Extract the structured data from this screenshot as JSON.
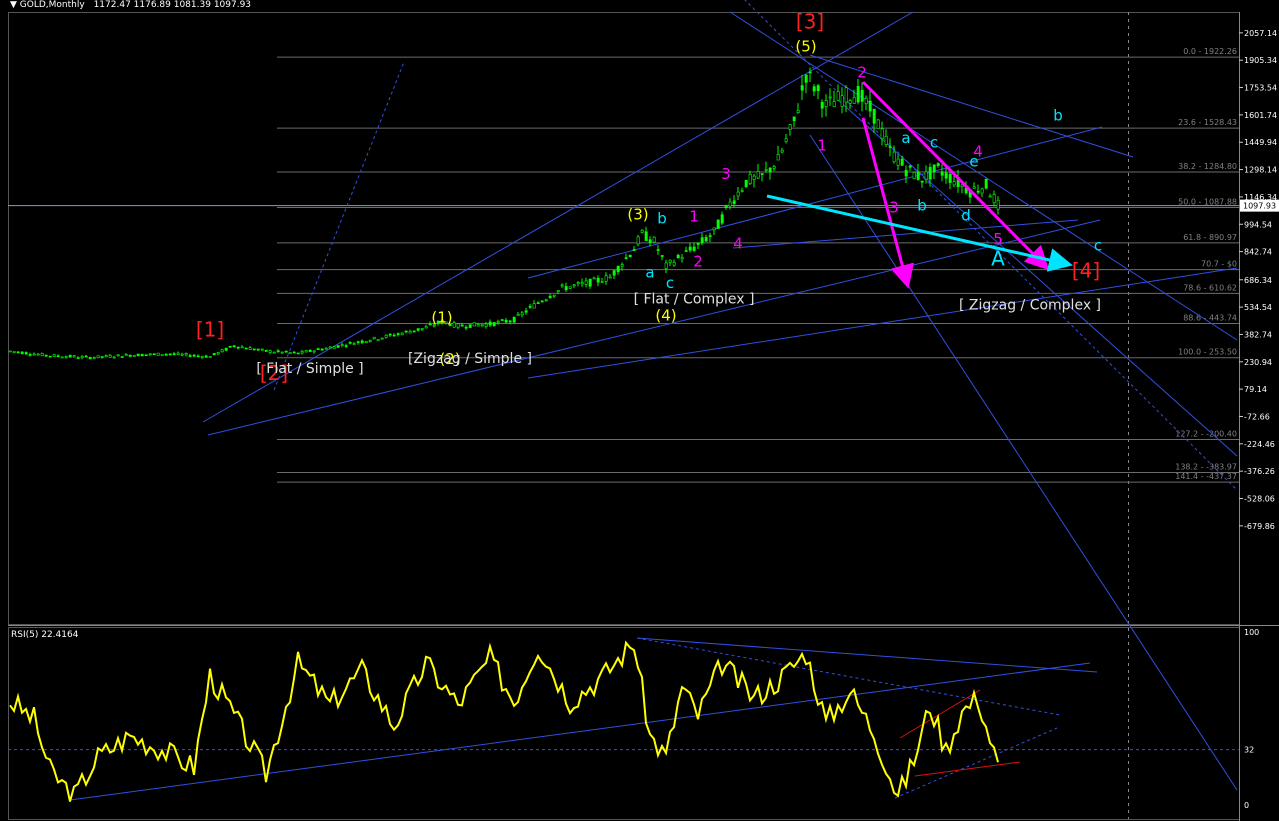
{
  "window": {
    "symbol": "GOLD,Monthly",
    "ohlc": "1172.47 1176.89 1081.39 1097.93"
  },
  "colors": {
    "background": "#000000",
    "grid": "#2a2a2a",
    "axis_text": "#ffffff",
    "candle": "#00ff00",
    "trendline": "#3050e0",
    "fib_line": "#6b6b6b",
    "fib_text": "#808080",
    "rsi_line": "#ffff00",
    "label_red": "#ff2020",
    "label_yellow": "#ffff00",
    "label_magenta": "#ff00ff",
    "label_cyan": "#00e5ff",
    "label_white": "#e0e0e0",
    "price_box_bg": "#ffffff",
    "price_box_text": "#000000"
  },
  "price_panel": {
    "current_price": "1097.93",
    "axis_ticks": [
      {
        "label": "2057.14",
        "value": 2057.14
      },
      {
        "label": "1905.34",
        "value": 1905.34
      },
      {
        "label": "1753.54",
        "value": 1753.54
      },
      {
        "label": "1601.74",
        "value": 1601.74
      },
      {
        "label": "1449.94",
        "value": 1449.94
      },
      {
        "label": "1298.14",
        "value": 1298.14
      },
      {
        "label": "1146.34",
        "value": 1146.34
      },
      {
        "label": "994.54",
        "value": 994.54
      },
      {
        "label": "842.74",
        "value": 842.74
      },
      {
        "label": "686.34",
        "value": 686.34
      },
      {
        "label": "534.54",
        "value": 534.54
      },
      {
        "label": "382.74",
        "value": 382.74
      },
      {
        "label": "230.94",
        "value": 230.94
      },
      {
        "label": "79.14",
        "value": 79.14
      },
      {
        "label": "-72.66",
        "value": -72.66
      },
      {
        "label": "-224.46",
        "value": -224.46
      },
      {
        "label": "-376.26",
        "value": -376.26
      },
      {
        "label": "-528.06",
        "value": -528.06
      },
      {
        "label": "-679.86",
        "value": -679.86
      }
    ],
    "fib_levels": [
      {
        "label": "0.0 - 1922.26",
        "value": 1922.26
      },
      {
        "label": "23.6 - 1528.43",
        "value": 1528.43
      },
      {
        "label": "38.2 - 1284.80",
        "value": 1284.8
      },
      {
        "label": "50.0 - 1087.88",
        "value": 1087.88
      },
      {
        "label": "61.8 - 890.97",
        "value": 890.97
      },
      {
        "label": "70.7 - $0",
        "value": 742.5
      },
      {
        "label": "78.6 - 610.62",
        "value": 610.62
      },
      {
        "label": "88.6 - 443.74",
        "value": 443.74
      },
      {
        "label": "100.0 - 253.50",
        "value": 253.5
      },
      {
        "label": "127.2 - -200.40",
        "value": -200.4
      },
      {
        "label": "138.2 - -383.97",
        "value": -383.97
      },
      {
        "label": "141.4 - -437.37",
        "value": -437.37
      }
    ],
    "wave_labels": [
      {
        "text": "[1]",
        "color": "red",
        "price": 370,
        "bar": 50
      },
      {
        "text": "[2]",
        "color": "red",
        "price": 130,
        "bar": 66
      },
      {
        "text": "[3]",
        "color": "red",
        "price": 2080,
        "bar": 200
      },
      {
        "text": "[4]",
        "color": "red",
        "price": 700,
        "bar": 269
      },
      {
        "text": "(1)",
        "color": "yellow",
        "price": 450,
        "bar": 108
      },
      {
        "text": "(2)",
        "color": "yellow",
        "price": 220,
        "bar": 110
      },
      {
        "text": "(3)",
        "color": "yellow",
        "price": 1020,
        "bar": 157
      },
      {
        "text": "(4)",
        "color": "yellow",
        "price": 460,
        "bar": 164
      },
      {
        "text": "(5)",
        "color": "yellow",
        "price": 1955,
        "bar": 199
      },
      {
        "text": "[Zigzag / Simple ]",
        "color": "white",
        "price": 225,
        "bar": 115
      },
      {
        "text": "[ Flat / Simple ]",
        "color": "white",
        "price": 170,
        "bar": 75
      },
      {
        "text": "[ Flat / Complex ]",
        "color": "white",
        "price": 555,
        "bar": 171
      },
      {
        "text": "[ Zigzag / Complex ]",
        "color": "white",
        "price": 520,
        "bar": 255
      },
      {
        "text": "a",
        "color": "cyan",
        "price": 700,
        "bar": 160
      },
      {
        "text": "b",
        "color": "cyan",
        "price": 1000,
        "bar": 163
      },
      {
        "text": "c",
        "color": "cyan",
        "price": 640,
        "bar": 165
      },
      {
        "text": "1",
        "color": "magenta",
        "price": 1010,
        "bar": 171
      },
      {
        "text": "2",
        "color": "magenta",
        "price": 760,
        "bar": 172
      },
      {
        "text": "3",
        "color": "magenta",
        "price": 1245,
        "bar": 179
      },
      {
        "text": "4",
        "color": "magenta",
        "price": 860,
        "bar": 182
      },
      {
        "text": "1",
        "color": "magenta",
        "price": 1405,
        "bar": 203
      },
      {
        "text": "2",
        "color": "magenta",
        "price": 1810,
        "bar": 213
      },
      {
        "text": "3",
        "color": "magenta",
        "price": 1060,
        "bar": 221
      },
      {
        "text": "4",
        "color": "magenta",
        "price": 1370,
        "bar": 242
      },
      {
        "text": "5",
        "color": "magenta",
        "price": 885,
        "bar": 247
      },
      {
        "text": "a",
        "color": "cyan",
        "price": 1445,
        "bar": 224
      },
      {
        "text": "b",
        "color": "cyan",
        "price": 1070,
        "bar": 228
      },
      {
        "text": "c",
        "color": "cyan",
        "price": 1420,
        "bar": 231
      },
      {
        "text": "d",
        "color": "cyan",
        "price": 1015,
        "bar": 239
      },
      {
        "text": "e",
        "color": "cyan",
        "price": 1315,
        "bar": 241
      },
      {
        "text": "A",
        "color": "cyan",
        "price": 765,
        "bar": 247
      },
      {
        "text": "b",
        "color": "cyan",
        "price": 1570,
        "bar": 262
      },
      {
        "text": "c",
        "color": "cyan",
        "price": 850,
        "bar": 272
      }
    ]
  },
  "rsi_panel": {
    "title": "RSI(5) 22.4164",
    "axis_ticks": [
      {
        "label": "100",
        "value": 100
      },
      {
        "label": "32",
        "value": 32
      },
      {
        "label": "0",
        "value": 0
      }
    ],
    "level": 32
  },
  "chart_data": {
    "type": "line",
    "title": "GOLD,Monthly",
    "series": [
      {
        "name": "GOLD,Monthly",
        "description_points": [
          {
            "bar": 0,
            "close": 290
          },
          {
            "bar": 10,
            "close": 265
          },
          {
            "bar": 20,
            "close": 255
          },
          {
            "bar": 30,
            "close": 268
          },
          {
            "bar": 40,
            "close": 275
          },
          {
            "bar": 48,
            "close": 262
          },
          {
            "bar": 50,
            "close": 260
          },
          {
            "bar": 56,
            "close": 320
          },
          {
            "bar": 64,
            "close": 290
          },
          {
            "bar": 72,
            "close": 278
          },
          {
            "bar": 80,
            "close": 310
          },
          {
            "bar": 88,
            "close": 345
          },
          {
            "bar": 96,
            "close": 380
          },
          {
            "bar": 104,
            "close": 420
          },
          {
            "bar": 108,
            "close": 455
          },
          {
            "bar": 112,
            "close": 430
          },
          {
            "bar": 120,
            "close": 440
          },
          {
            "bar": 126,
            "close": 465
          },
          {
            "bar": 132,
            "close": 560
          },
          {
            "bar": 138,
            "close": 640
          },
          {
            "bar": 144,
            "close": 665
          },
          {
            "bar": 150,
            "close": 700
          },
          {
            "bar": 156,
            "close": 860
          },
          {
            "bar": 158,
            "close": 940
          },
          {
            "bar": 161,
            "close": 900
          },
          {
            "bar": 164,
            "close": 760
          },
          {
            "bar": 168,
            "close": 820
          },
          {
            "bar": 172,
            "close": 880
          },
          {
            "bar": 176,
            "close": 950
          },
          {
            "bar": 180,
            "close": 1110
          },
          {
            "bar": 184,
            "close": 1230
          },
          {
            "bar": 188,
            "close": 1260
          },
          {
            "bar": 192,
            "close": 1350
          },
          {
            "bar": 196,
            "close": 1560
          },
          {
            "bar": 199,
            "close": 1830
          },
          {
            "bar": 200,
            "close": 1800
          },
          {
            "bar": 204,
            "close": 1650
          },
          {
            "bar": 208,
            "close": 1700
          },
          {
            "bar": 212,
            "close": 1720
          },
          {
            "bar": 216,
            "close": 1600
          },
          {
            "bar": 220,
            "close": 1400
          },
          {
            "bar": 224,
            "close": 1300
          },
          {
            "bar": 228,
            "close": 1250
          },
          {
            "bar": 232,
            "close": 1300
          },
          {
            "bar": 236,
            "close": 1240
          },
          {
            "bar": 240,
            "close": 1180
          },
          {
            "bar": 244,
            "close": 1210
          },
          {
            "bar": 247,
            "close": 1098
          }
        ]
      },
      {
        "name": "RSI(5)",
        "points": [
          {
            "bar": 0,
            "value": 60
          },
          {
            "bar": 6,
            "value": 50
          },
          {
            "bar": 10,
            "value": 20
          },
          {
            "bar": 16,
            "value": 5
          },
          {
            "bar": 22,
            "value": 28
          },
          {
            "bar": 30,
            "value": 40
          },
          {
            "bar": 38,
            "value": 32
          },
          {
            "bar": 46,
            "value": 22
          },
          {
            "bar": 50,
            "value": 75
          },
          {
            "bar": 56,
            "value": 52
          },
          {
            "bar": 64,
            "value": 18
          },
          {
            "bar": 72,
            "value": 82
          },
          {
            "bar": 80,
            "value": 58
          },
          {
            "bar": 88,
            "value": 78
          },
          {
            "bar": 96,
            "value": 46
          },
          {
            "bar": 104,
            "value": 82
          },
          {
            "bar": 112,
            "value": 58
          },
          {
            "bar": 120,
            "value": 85
          },
          {
            "bar": 126,
            "value": 60
          },
          {
            "bar": 132,
            "value": 92
          },
          {
            "bar": 140,
            "value": 60
          },
          {
            "bar": 148,
            "value": 74
          },
          {
            "bar": 156,
            "value": 94
          },
          {
            "bar": 160,
            "value": 40
          },
          {
            "bar": 164,
            "value": 28
          },
          {
            "bar": 168,
            "value": 68
          },
          {
            "bar": 172,
            "value": 52
          },
          {
            "bar": 178,
            "value": 82
          },
          {
            "bar": 186,
            "value": 62
          },
          {
            "bar": 192,
            "value": 72
          },
          {
            "bar": 199,
            "value": 88
          },
          {
            "bar": 204,
            "value": 48
          },
          {
            "bar": 210,
            "value": 66
          },
          {
            "bar": 216,
            "value": 42
          },
          {
            "bar": 222,
            "value": 5
          },
          {
            "bar": 226,
            "value": 26
          },
          {
            "bar": 230,
            "value": 58
          },
          {
            "bar": 234,
            "value": 32
          },
          {
            "bar": 238,
            "value": 54
          },
          {
            "bar": 242,
            "value": 62
          },
          {
            "bar": 245,
            "value": 38
          },
          {
            "bar": 247,
            "value": 22
          }
        ]
      }
    ],
    "x_range": [
      0,
      280
    ],
    "ylim_price": [
      -700,
      2070
    ],
    "ylim_rsi": [
      0,
      100
    ],
    "grid": false,
    "legend": "none"
  }
}
